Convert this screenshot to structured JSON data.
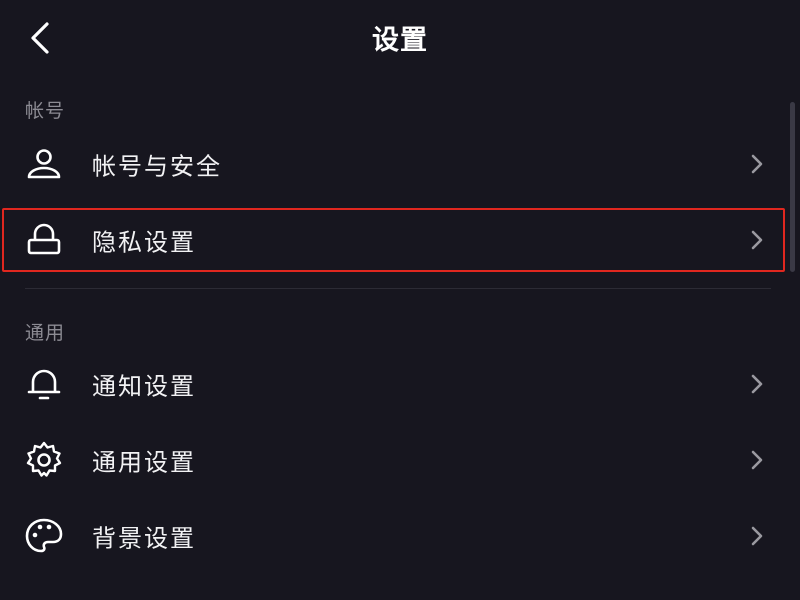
{
  "header": {
    "title": "设置",
    "back_icon": "chevron-left-icon"
  },
  "sections": [
    {
      "label": "帐号",
      "items": [
        {
          "label": "帐号与安全",
          "icon": "user-icon"
        },
        {
          "label": "隐私设置",
          "icon": "lock-icon",
          "highlighted": true
        }
      ]
    },
    {
      "label": "通用",
      "items": [
        {
          "label": "通知设置",
          "icon": "bell-icon"
        },
        {
          "label": "通用设置",
          "icon": "gear-icon"
        },
        {
          "label": "背景设置",
          "icon": "palette-icon"
        }
      ]
    }
  ],
  "colors": {
    "background": "#17161f",
    "text": "#f2f2f4",
    "section_label": "#8c8b93",
    "highlight_border": "#e0271f",
    "chevron": "#9a99a0"
  }
}
